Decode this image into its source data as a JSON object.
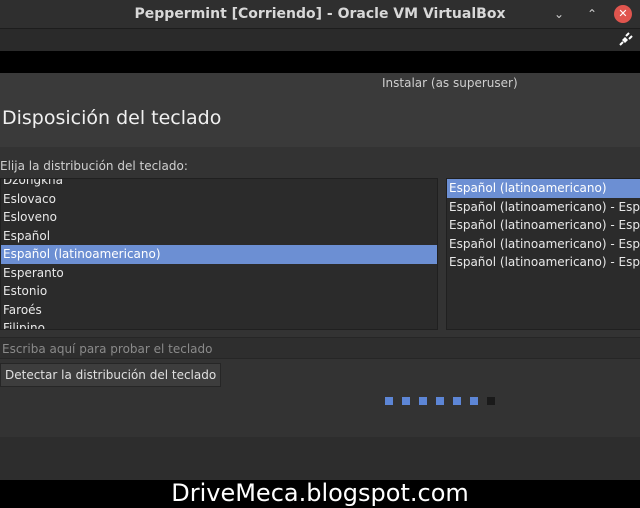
{
  "window": {
    "title": "Peppermint [Corriendo] - Oracle VM VirtualBox",
    "min_symbol": "⌄",
    "restore_symbol": "⌃",
    "close_symbol": "✕"
  },
  "toolbar": {
    "icon": "plug-icon"
  },
  "installer": {
    "window_title": "Instalar (as superuser)",
    "heading": "Disposición del teclado",
    "prompt": "Elija la distribución del teclado:",
    "layouts": [
      "Dzongkha",
      "Eslovaco",
      "Esloveno",
      "Español",
      "Español (latinoamericano)",
      "Esperanto",
      "Estonio",
      "Faroés",
      "Filipino"
    ],
    "selected_layout": "Español (latinoamericano)",
    "variants": [
      "Español (latinoamericano)",
      "Español (latinoamericano) - Españ",
      "Español (latinoamericano) - Españ",
      "Español (latinoamericano) - Españ",
      "Español (latinoamericano) - Españ"
    ],
    "test_placeholder": "Escriba aquí para probar el teclado",
    "detect_button": "Detectar la distribución del teclado",
    "progress": {
      "total_steps": 7,
      "completed_steps": 6
    }
  },
  "watermark": "DriveMeca.blogspot.com",
  "colors": {
    "selection": "#6c8fd3",
    "progress": "#5d86d6",
    "close": "#e0554e"
  }
}
